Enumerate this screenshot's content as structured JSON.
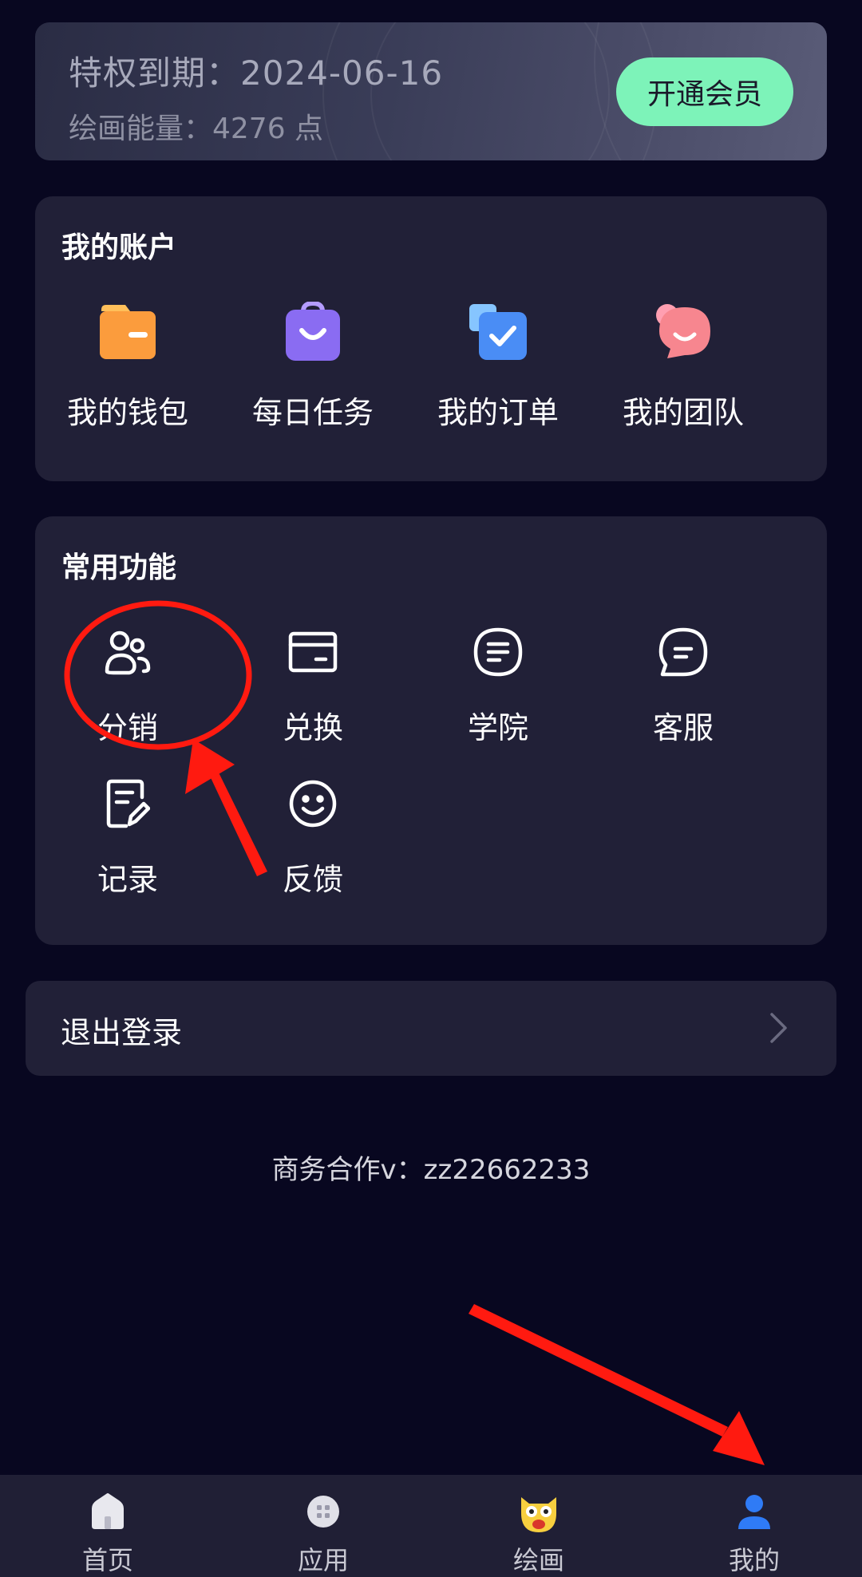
{
  "vip": {
    "expire_text": "特权到期：2024-06-16",
    "energy_text": "绘画能量：4276 点",
    "button_label": "开通会员",
    "button_color": "#7df3b9"
  },
  "account": {
    "title": "我的账户",
    "items": [
      {
        "label": "我的钱包",
        "icon": "wallet-icon",
        "color": "#fb9c3d"
      },
      {
        "label": "每日任务",
        "icon": "task-bag-icon",
        "color": "#8a6cf2"
      },
      {
        "label": "我的订单",
        "icon": "order-check-icon",
        "color": "#4a8df5"
      },
      {
        "label": "我的团队",
        "icon": "team-chat-icon",
        "color": "#f7868f"
      }
    ]
  },
  "common": {
    "title": "常用功能",
    "items": [
      {
        "label": "分销",
        "icon": "users-icon"
      },
      {
        "label": "兑换",
        "icon": "card-icon"
      },
      {
        "label": "学院",
        "icon": "document-icon"
      },
      {
        "label": "客服",
        "icon": "chat-bubble-icon"
      },
      {
        "label": "记录",
        "icon": "edit-record-icon"
      },
      {
        "label": "反馈",
        "icon": "smiley-icon"
      }
    ]
  },
  "logout": {
    "label": "退出登录"
  },
  "contact": {
    "text": "商务合作v：zz22662233"
  },
  "nav": {
    "items": [
      {
        "label": "首页",
        "icon": "home-icon"
      },
      {
        "label": "应用",
        "icon": "apps-icon"
      },
      {
        "label": "绘画",
        "icon": "cartoon-face-icon"
      },
      {
        "label": "我的",
        "icon": "user-icon",
        "active": true
      }
    ],
    "active_color": "#2f7bf6"
  },
  "annotations": {
    "color": "#ff1a10"
  }
}
